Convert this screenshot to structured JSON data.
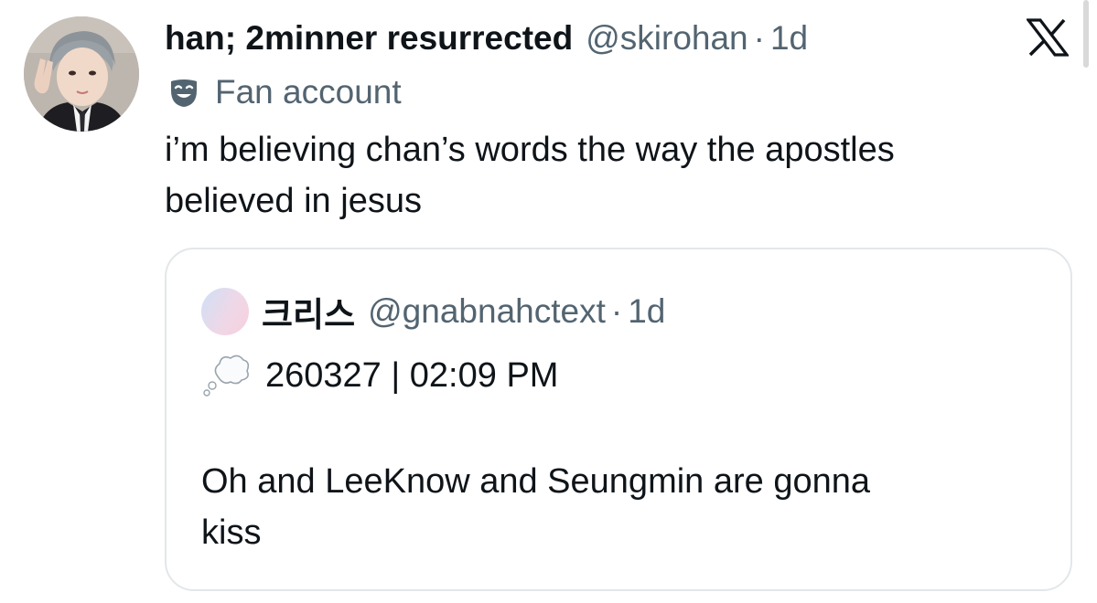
{
  "tweet": {
    "display_name": "han; 2minner resurrected",
    "handle": "@skirohan",
    "separator": "·",
    "time": "1d",
    "label": "Fan account",
    "text_lines": [
      "i’m believing chan’s words the way the apostles",
      "believed in jesus"
    ]
  },
  "quote": {
    "display_name": "크리스",
    "handle": "@gnabnahctext",
    "separator": "·",
    "time": "1d",
    "stamp": "260327 | 02:09 PM",
    "body_lines": [
      "Oh and LeeKnow and Seungmin are gonna",
      "kiss"
    ]
  },
  "icons": {
    "brand": "x-logo-icon",
    "label_badge": "theater-mask-icon",
    "thought": "thought-balloon-icon"
  },
  "colors": {
    "text_primary": "#0f1419",
    "text_secondary": "#536471",
    "card_border": "#e3e7ea"
  }
}
